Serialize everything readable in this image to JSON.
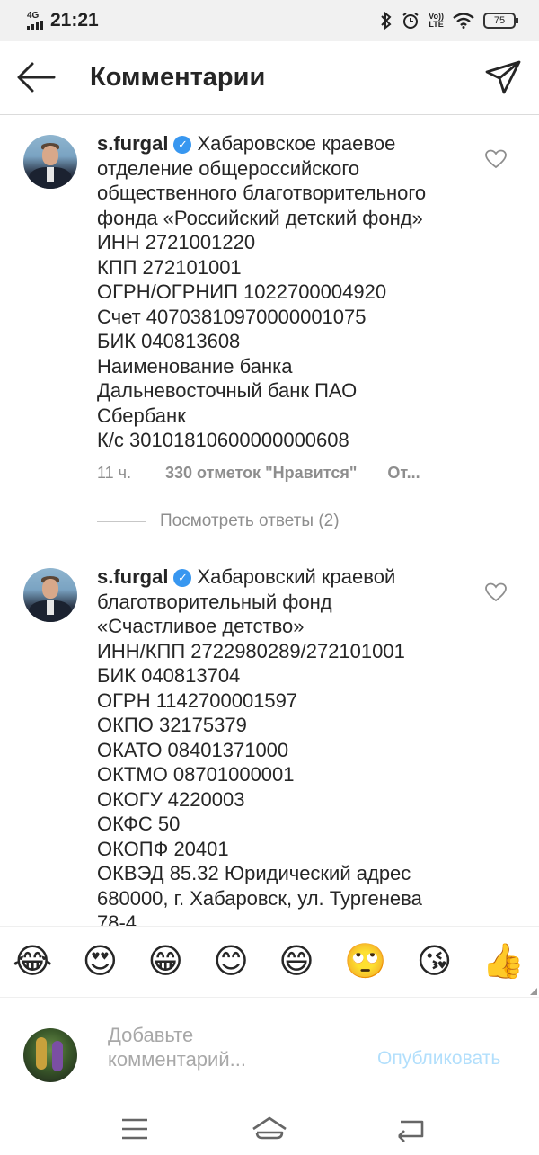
{
  "status_bar": {
    "network": "4G",
    "time": "21:21",
    "icons": [
      "bluetooth-icon",
      "alarm-icon",
      "volte-icon",
      "wifi-icon"
    ],
    "volte_text": "VoLTE",
    "battery": "75"
  },
  "header": {
    "title": "Комментарии",
    "back_icon": "arrow-left-icon",
    "send_icon": "paper-plane-icon"
  },
  "comments": [
    {
      "username": "s.furgal",
      "verified": true,
      "lines": [
        "Хабаровское краевое",
        "отделение общероссийского",
        "общественного благотворительного",
        "фонда «Российский детский фонд»",
        "ИНН 2721001220",
        "КПП 272101001",
        "ОГРН/ОГРНИП 1022700004920",
        "Счет 40703810970000001075",
        "БИК 040813608",
        "Наименование банка",
        "Дальневосточный банк ПАО",
        "Сбербанк",
        "К/с 30101810600000000608"
      ],
      "time_ago": "11 ч.",
      "likes": "330 отметок \"Нравится\"",
      "reply": "От...",
      "view_replies": "Посмотреть ответы (2)"
    },
    {
      "username": "s.furgal",
      "verified": true,
      "lines": [
        "Хабаровский краевой",
        "благотворительный фонд",
        "«Счастливое детство»",
        "ИНН/КПП 2722980289/272101001",
        "БИК 040813704",
        "ОГРН 1142700001597",
        "ОКПО 32175379",
        "ОКАТО 08401371000",
        "ОКТМО 08701000001",
        "ОКОГУ 4220003",
        "ОКФС 50",
        "ОКОПФ  20401",
        "ОКВЭД 85.32 Юридический адрес",
        "680000, г. Хабаровск, ул. Тургенева",
        "78-4"
      ]
    }
  ],
  "emojis": [
    "😂",
    "😍",
    "😁",
    "😊",
    "😄",
    "🙄",
    "😘",
    "👍"
  ],
  "add_comment": {
    "placeholder_line1": "Добавьте",
    "placeholder_line2": "комментарий...",
    "publish": "Опубликовать"
  },
  "nav_bar": [
    "menu-icon",
    "home-icon",
    "back-icon"
  ]
}
